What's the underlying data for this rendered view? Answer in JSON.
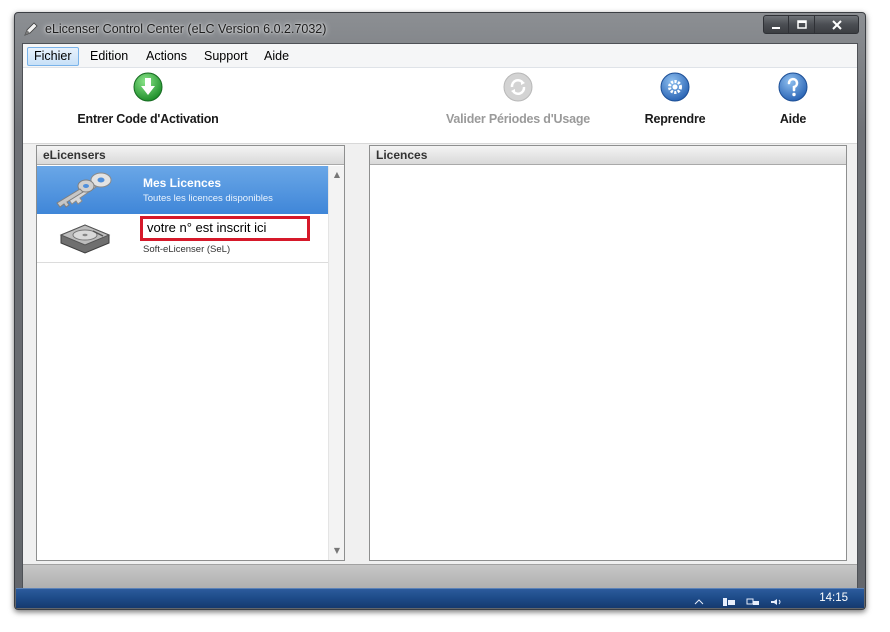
{
  "window": {
    "title": "eLicenser Control Center (eLC Version 6.0.2.7032)",
    "controls": {
      "minimize": "minimize",
      "maximize": "maximize",
      "close": "close"
    }
  },
  "menu": {
    "items": [
      "Fichier",
      "Edition",
      "Actions",
      "Support",
      "Aide"
    ],
    "active": "Fichier"
  },
  "toolbar": {
    "enter_code": "Entrer Code d'Activation",
    "validate_periods": "Valider Périodes d'Usage",
    "resume": "Reprendre",
    "help": "Aide"
  },
  "panels": {
    "left_title": "eLicensers",
    "right_title": "Licences"
  },
  "licensers": [
    {
      "title": "Mes Licences",
      "subtitle": "Toutes les licences disponibles",
      "icon": "keys-icon"
    },
    {
      "title": "votre n° est inscrit ici",
      "subtitle": "Soft-eLicenser (SeL)",
      "icon": "hard-drive-icon"
    }
  ],
  "taskbar": {
    "time": "14:15"
  },
  "colors": {
    "selection": "#3f86d8",
    "highlight_box": "#d6192a",
    "toolbar_green": "#27a33a",
    "toolbar_blue": "#2f6fbf"
  }
}
